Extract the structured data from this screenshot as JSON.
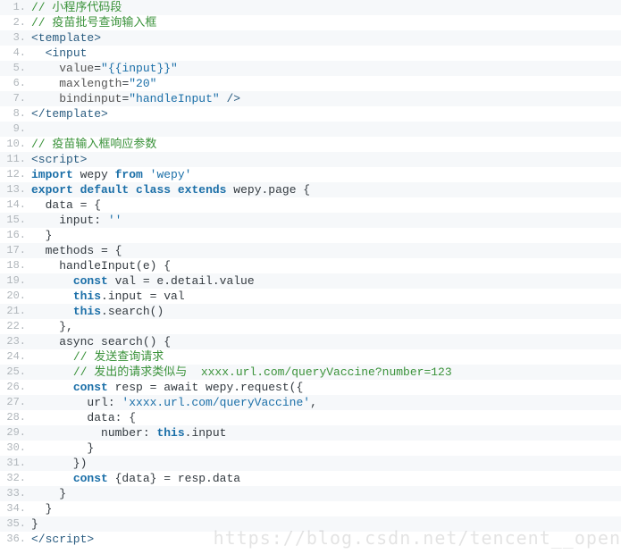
{
  "watermark": "https://blog.csdn.net/tencent__open",
  "lines": [
    {
      "n": "1.",
      "segs": [
        [
          "comment",
          "// 小程序代码段"
        ]
      ]
    },
    {
      "n": "2.",
      "segs": [
        [
          "comment",
          "// 疫苗批号查询输入框"
        ]
      ]
    },
    {
      "n": "3.",
      "segs": [
        [
          "tag",
          "<template>"
        ]
      ]
    },
    {
      "n": "4.",
      "segs": [
        [
          "plain",
          "  "
        ],
        [
          "tag",
          "<input"
        ]
      ]
    },
    {
      "n": "5.",
      "segs": [
        [
          "plain",
          "    "
        ],
        [
          "attr",
          "value"
        ],
        [
          "plain",
          "="
        ],
        [
          "string",
          "\"{{input}}\""
        ]
      ]
    },
    {
      "n": "6.",
      "segs": [
        [
          "plain",
          "    "
        ],
        [
          "attr",
          "maxlength"
        ],
        [
          "plain",
          "="
        ],
        [
          "string",
          "\"20\""
        ]
      ]
    },
    {
      "n": "7.",
      "segs": [
        [
          "plain",
          "    "
        ],
        [
          "attr",
          "bindinput"
        ],
        [
          "plain",
          "="
        ],
        [
          "string",
          "\"handleInput\""
        ],
        [
          "plain",
          " "
        ],
        [
          "tag",
          "/>"
        ]
      ]
    },
    {
      "n": "8.",
      "segs": [
        [
          "tag",
          "</template>"
        ]
      ]
    },
    {
      "n": "9.",
      "segs": [
        [
          "plain",
          ""
        ]
      ]
    },
    {
      "n": "10.",
      "segs": [
        [
          "comment",
          "// 疫苗输入框响应参数"
        ]
      ]
    },
    {
      "n": "11.",
      "segs": [
        [
          "tag",
          "<script>"
        ]
      ]
    },
    {
      "n": "12.",
      "segs": [
        [
          "keyword",
          "import"
        ],
        [
          "plain",
          " wepy "
        ],
        [
          "keyword",
          "from"
        ],
        [
          "plain",
          " "
        ],
        [
          "string",
          "'wepy'"
        ]
      ]
    },
    {
      "n": "13.",
      "segs": [
        [
          "keyword",
          "export"
        ],
        [
          "plain",
          " "
        ],
        [
          "keyword",
          "default"
        ],
        [
          "plain",
          " "
        ],
        [
          "keyword",
          "class"
        ],
        [
          "plain",
          " "
        ],
        [
          "keyword",
          "extends"
        ],
        [
          "plain",
          " wepy.page {"
        ]
      ]
    },
    {
      "n": "14.",
      "segs": [
        [
          "plain",
          "  data = {"
        ]
      ]
    },
    {
      "n": "15.",
      "segs": [
        [
          "plain",
          "    input: "
        ],
        [
          "string",
          "''"
        ]
      ]
    },
    {
      "n": "16.",
      "segs": [
        [
          "plain",
          "  }"
        ]
      ]
    },
    {
      "n": "17.",
      "segs": [
        [
          "plain",
          "  methods = {"
        ]
      ]
    },
    {
      "n": "18.",
      "segs": [
        [
          "plain",
          "    handleInput(e) {"
        ]
      ]
    },
    {
      "n": "19.",
      "segs": [
        [
          "plain",
          "      "
        ],
        [
          "keyword",
          "const"
        ],
        [
          "plain",
          " val = e.detail.value"
        ]
      ]
    },
    {
      "n": "20.",
      "segs": [
        [
          "plain",
          "      "
        ],
        [
          "keyword",
          "this"
        ],
        [
          "plain",
          ".input = val"
        ]
      ]
    },
    {
      "n": "21.",
      "segs": [
        [
          "plain",
          "      "
        ],
        [
          "keyword",
          "this"
        ],
        [
          "plain",
          ".search()"
        ]
      ]
    },
    {
      "n": "22.",
      "segs": [
        [
          "plain",
          "    },"
        ]
      ]
    },
    {
      "n": "23.",
      "segs": [
        [
          "plain",
          "    async search() {"
        ]
      ]
    },
    {
      "n": "24.",
      "segs": [
        [
          "plain",
          "      "
        ],
        [
          "comment",
          "// 发送查询请求"
        ]
      ]
    },
    {
      "n": "25.",
      "segs": [
        [
          "plain",
          "      "
        ],
        [
          "comment",
          "// 发出的请求类似与  xxxx.url.com/queryVaccine?number=123"
        ]
      ]
    },
    {
      "n": "26.",
      "segs": [
        [
          "plain",
          "      "
        ],
        [
          "keyword",
          "const"
        ],
        [
          "plain",
          " resp = await wepy.request({"
        ]
      ]
    },
    {
      "n": "27.",
      "segs": [
        [
          "plain",
          "        url: "
        ],
        [
          "string",
          "'xxxx.url.com/queryVaccine'"
        ],
        [
          "plain",
          ","
        ]
      ]
    },
    {
      "n": "28.",
      "segs": [
        [
          "plain",
          "        data: {"
        ]
      ]
    },
    {
      "n": "29.",
      "segs": [
        [
          "plain",
          "          number: "
        ],
        [
          "keyword",
          "this"
        ],
        [
          "plain",
          ".input"
        ]
      ]
    },
    {
      "n": "30.",
      "segs": [
        [
          "plain",
          "        }"
        ]
      ]
    },
    {
      "n": "31.",
      "segs": [
        [
          "plain",
          "      })"
        ]
      ]
    },
    {
      "n": "32.",
      "segs": [
        [
          "plain",
          "      "
        ],
        [
          "keyword",
          "const"
        ],
        [
          "plain",
          " {data} = resp.data"
        ]
      ]
    },
    {
      "n": "33.",
      "segs": [
        [
          "plain",
          "    }"
        ]
      ]
    },
    {
      "n": "34.",
      "segs": [
        [
          "plain",
          "  }"
        ]
      ]
    },
    {
      "n": "35.",
      "segs": [
        [
          "plain",
          "}"
        ]
      ]
    },
    {
      "n": "36.",
      "segs": [
        [
          "tag",
          "</script"
        ],
        [
          "tag",
          ">"
        ]
      ]
    }
  ]
}
